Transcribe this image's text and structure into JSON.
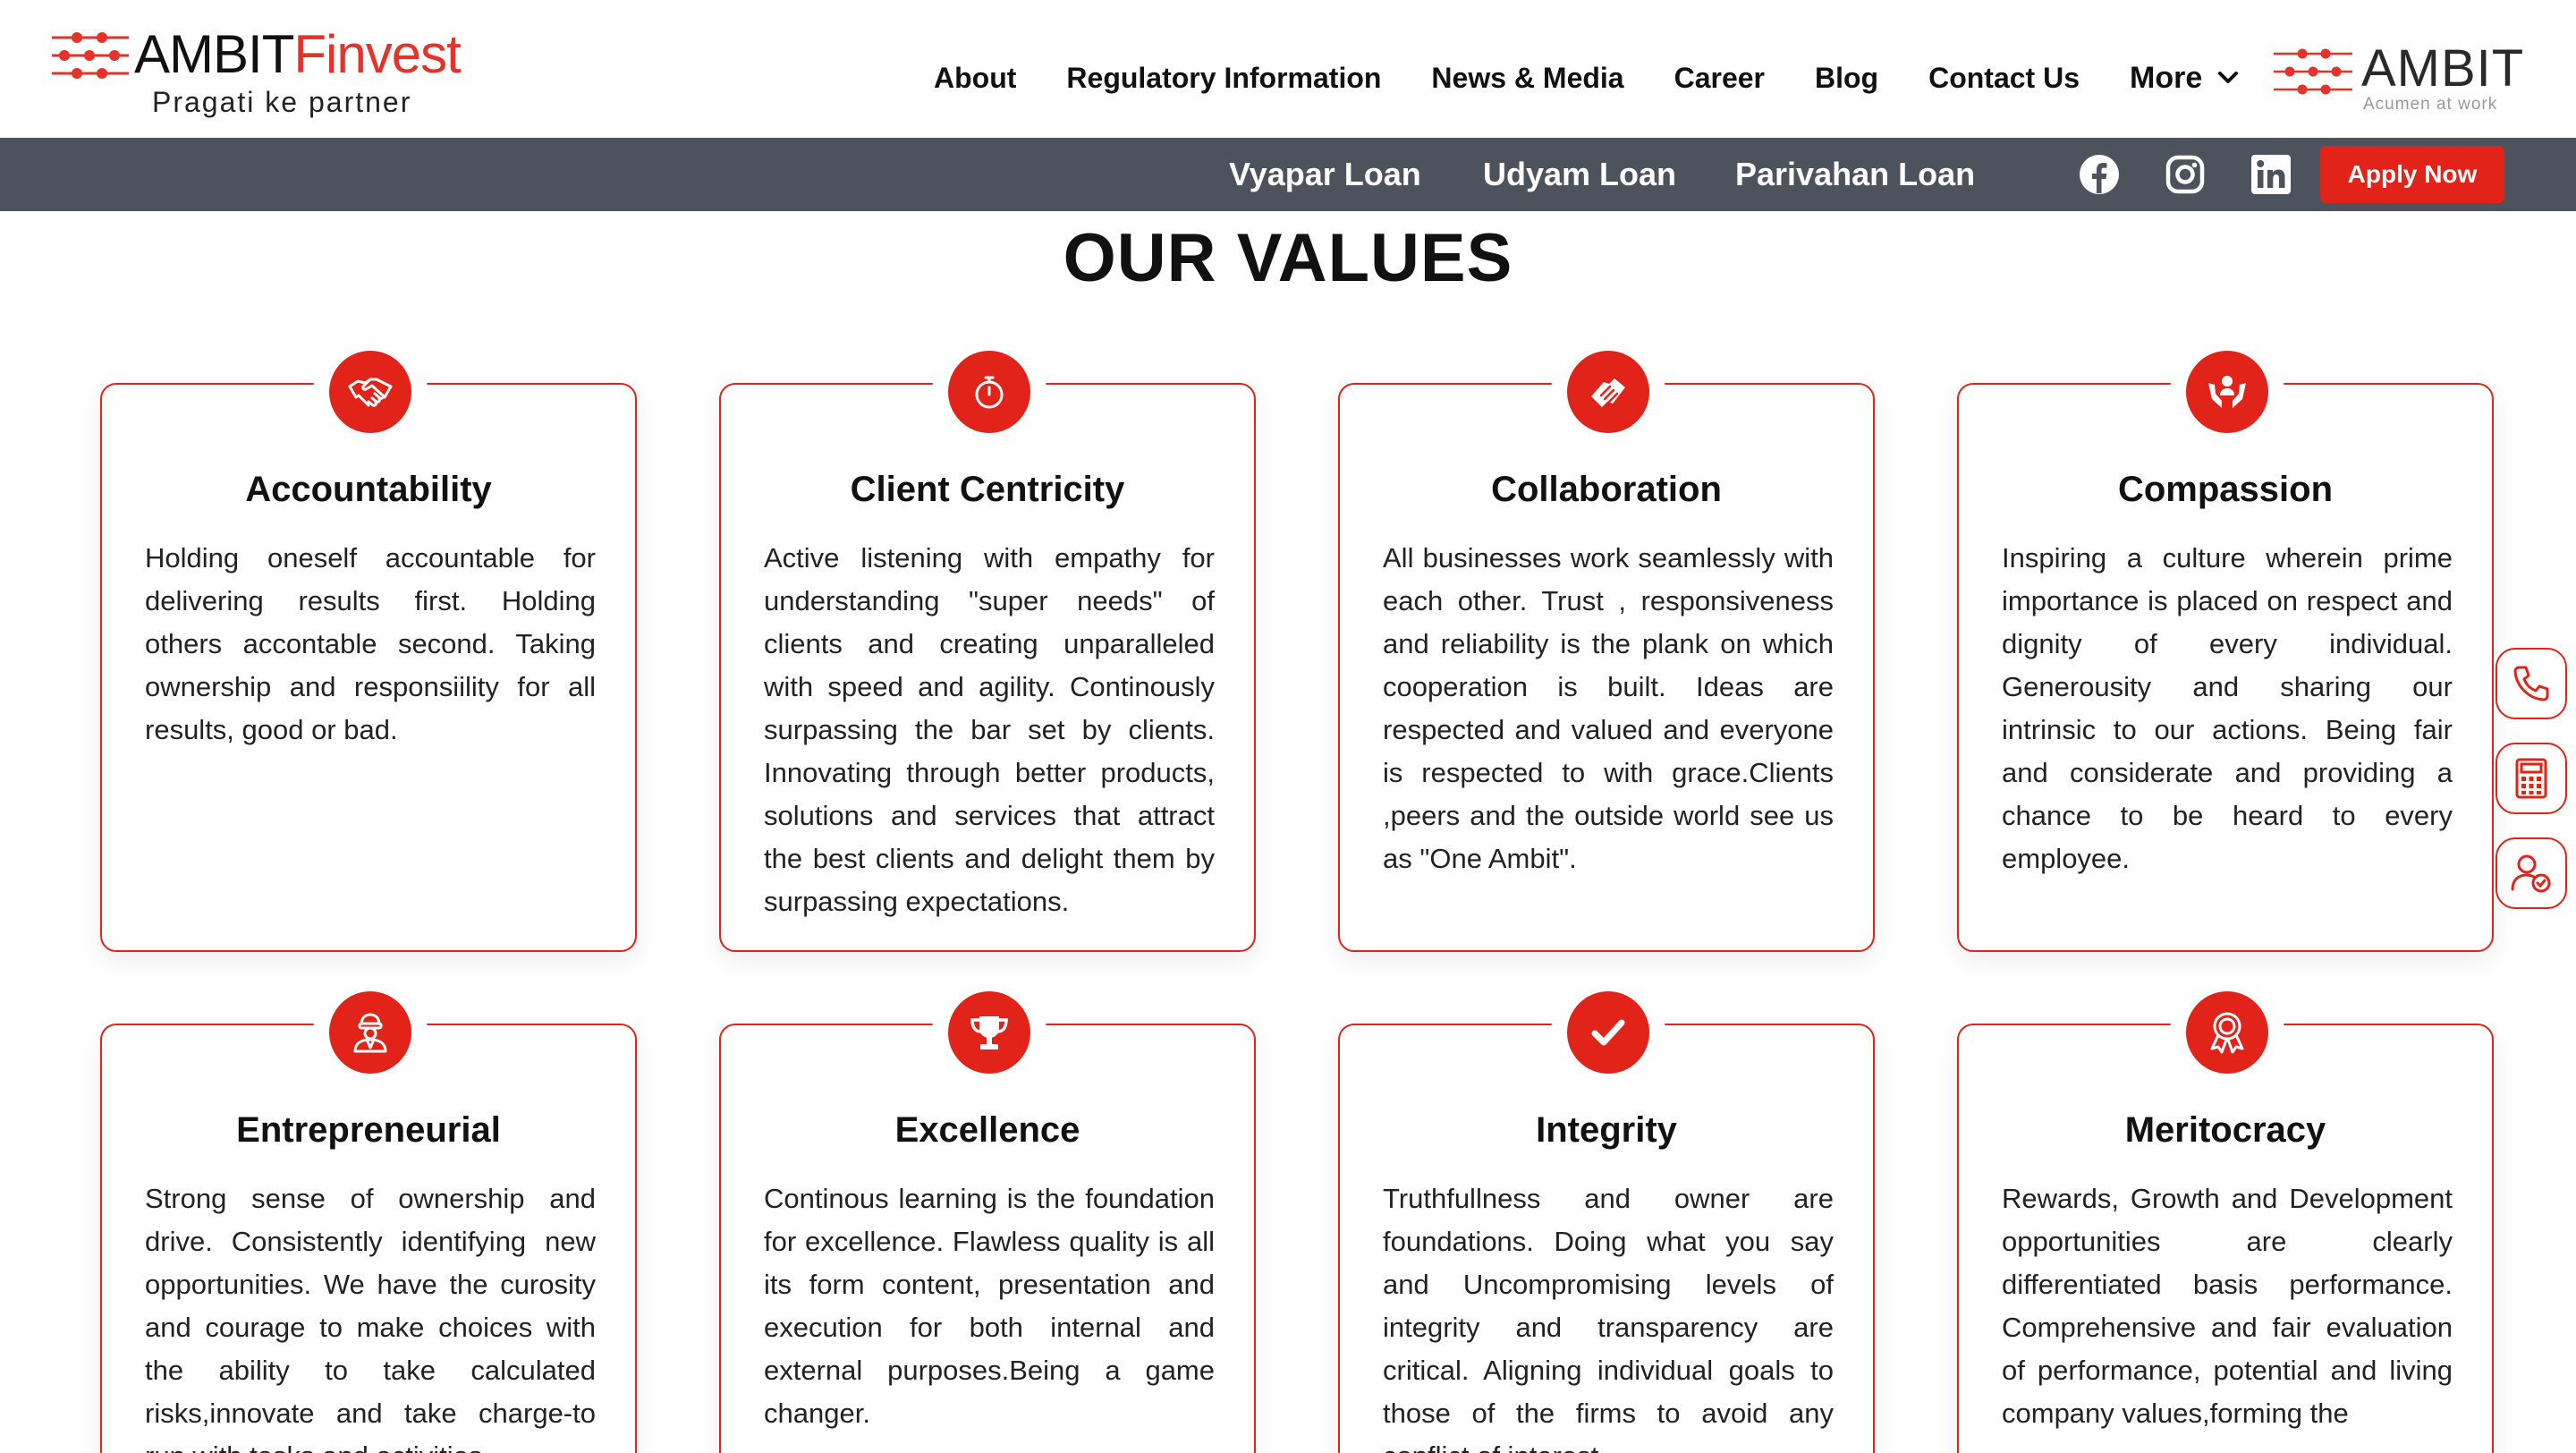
{
  "header": {
    "logo": {
      "name": "AMBIT",
      "name_accent": "Finvest",
      "tagline": "Pragati ke partner"
    },
    "nav": [
      "About",
      "Regulatory Information",
      "News & Media",
      "Career",
      "Blog",
      "Contact Us"
    ],
    "more_label": "More",
    "brand_right": {
      "name": "AMBIT",
      "tagline": "Acumen at work"
    }
  },
  "subbar": {
    "loans": [
      "Vyapar Loan",
      "Udyam Loan",
      "Parivahan Loan"
    ],
    "social": [
      "facebook-icon",
      "instagram-icon",
      "linkedin-icon"
    ],
    "apply_label": "Apply Now"
  },
  "section": {
    "title_light": "OUR",
    "title_bold": "VALUES"
  },
  "values": [
    {
      "title": "Accountability",
      "icon": "handshake-icon",
      "text": "Holding oneself accountable for delivering results first. Holding others accontable second. Taking ownership and responsiility for all results, good or bad."
    },
    {
      "title": "Client Centricity",
      "icon": "stopwatch-icon",
      "text": "Active listening with empathy for understanding \"super needs\" of clients and creating unparalleled with speed and agility. Continously surpassing the bar set by clients. Innovating through better products, solutions and services that attract the best clients and delight them by surpassing expectations."
    },
    {
      "title": "Collaboration",
      "icon": "collaboration-icon",
      "text": "All businesses work seamlessly with each other. Trust , responsiveness and reliability is the plank on which cooperation is built. Ideas are respected and valued and everyone is respected to with grace.Clients ,peers and the outside world see us as \"One Ambit\"."
    },
    {
      "title": "Compassion",
      "icon": "caring-hands-icon",
      "text": "Inspiring a culture wherein prime importance is placed on respect and dignity of every individual. Generousity and sharing our intrinsic to our actions. Being fair and considerate and providing a chance to be heard to every employee."
    },
    {
      "title": "Entrepreneurial",
      "icon": "entrepreneur-icon",
      "text": "Strong sense of ownership and drive. Consistently identifying new opportunities. We have the curosity and courage to make choices with the ability to take calculated risks,innovate and take charge-to run with tasks and activities"
    },
    {
      "title": "Excellence",
      "icon": "trophy-icon",
      "text": "Continous learning is the foundation for excellence. Flawless quality is all its form content, presentation and execution for both internal and external purposes.Being a game changer."
    },
    {
      "title": "Integrity",
      "icon": "checkmark-icon",
      "text": "Truthfullness and owner are foundations. Doing what you say and Uncompromising levels of integrity and transparency are critical. Aligning individual goals to those of the firms to avoid any conflict of interest."
    },
    {
      "title": "Meritocracy",
      "icon": "award-ribbon-icon",
      "text": "Rewards, Growth and Development opportunities are clearly differentiated basis performance. Comprehensive and fair evaluation of performance, potential and living company values,forming the"
    }
  ],
  "floating": [
    "phone-icon",
    "calculator-icon",
    "user-check-icon"
  ],
  "colors": {
    "accent": "#e2231a",
    "subbar": "#4c535c",
    "text": "#111111"
  }
}
